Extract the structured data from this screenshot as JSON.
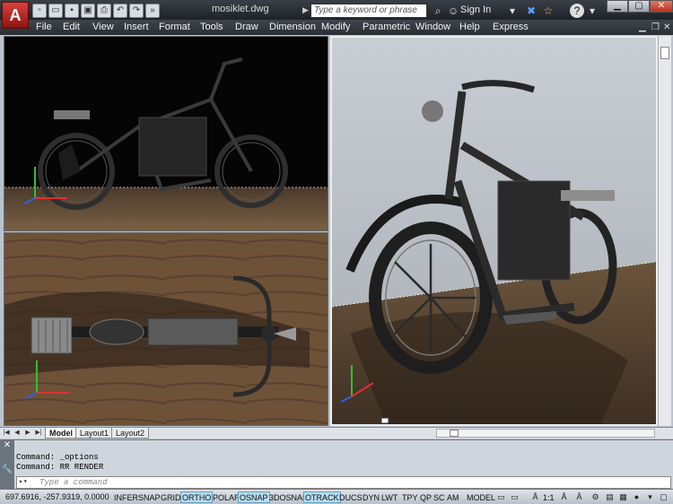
{
  "titlebar": {
    "app_letter": "A",
    "document_title": "mosiklet.dwg",
    "search_placeholder": "Type a keyword or phrase",
    "signin": "Sign In",
    "help": "?"
  },
  "quick_access": [
    "new-icon",
    "open-icon",
    "save-icon",
    "saveas-icon",
    "plot-icon",
    "undo-icon",
    "redo-icon",
    "more-icon"
  ],
  "menu": [
    "File",
    "Edit",
    "View",
    "Insert",
    "Format",
    "Tools",
    "Draw",
    "Dimension",
    "Modify",
    "Parametric",
    "Window",
    "Help",
    "Express"
  ],
  "layout_tabs": [
    "Model",
    "Layout1",
    "Layout2"
  ],
  "command": {
    "history": [
      "Command: _options",
      "Command: RR RENDER"
    ],
    "input_placeholder": "Type a command"
  },
  "status": {
    "coordinates": "697.6916, -257.9319, 0.0000",
    "toggles": [
      {
        "label": "INFER",
        "on": false
      },
      {
        "label": "SNAP",
        "on": false
      },
      {
        "label": "GRID",
        "on": false
      },
      {
        "label": "ORTHO",
        "on": true
      },
      {
        "label": "POLAR",
        "on": false
      },
      {
        "label": "OSNAP",
        "on": true
      },
      {
        "label": "3DOSNAP",
        "on": false
      },
      {
        "label": "OTRACK",
        "on": true
      },
      {
        "label": "DUCS",
        "on": false
      },
      {
        "label": "DYN",
        "on": false
      },
      {
        "label": "LWT",
        "on": false
      },
      {
        "label": "TPY",
        "on": false
      },
      {
        "label": "QP",
        "on": false
      },
      {
        "label": "SC",
        "on": false
      },
      {
        "label": "AM",
        "on": false
      }
    ],
    "model_label": "MODEL",
    "scale": "1:1"
  },
  "colors": {
    "toggle_on": "#b6dcf0",
    "ucs_x": "#e03030",
    "ucs_y": "#30c030",
    "ucs_z": "#3060e0"
  }
}
